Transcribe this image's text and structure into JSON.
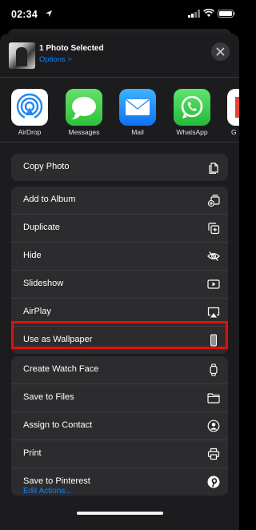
{
  "status_bar": {
    "time": "02:34"
  },
  "header": {
    "title": "1 Photo Selected",
    "options_label": "Options >"
  },
  "apps": [
    {
      "label": "AirDrop"
    },
    {
      "label": "Messages"
    },
    {
      "label": "Mail"
    },
    {
      "label": "WhatsApp"
    },
    {
      "label": "G"
    }
  ],
  "actions_group1": [
    {
      "label": "Copy Photo",
      "icon": "copy-icon"
    }
  ],
  "actions_group2": [
    {
      "label": "Add to Album",
      "icon": "add-to-album-icon"
    },
    {
      "label": "Duplicate",
      "icon": "duplicate-icon"
    },
    {
      "label": "Hide",
      "icon": "eye-slash-icon"
    },
    {
      "label": "Slideshow",
      "icon": "play-icon"
    },
    {
      "label": "AirPlay",
      "icon": "airplay-icon"
    },
    {
      "label": "Use as Wallpaper",
      "icon": "phone-icon"
    }
  ],
  "actions_group3": [
    {
      "label": "Create Watch Face",
      "icon": "watch-icon"
    },
    {
      "label": "Save to Files",
      "icon": "folder-icon"
    },
    {
      "label": "Assign to Contact",
      "icon": "contact-icon"
    },
    {
      "label": "Print",
      "icon": "printer-icon"
    },
    {
      "label": "Save to Pinterest",
      "icon": "pinterest-icon"
    }
  ],
  "footer": {
    "edit_actions": "Edit Actions..."
  },
  "colors": {
    "accent": "#0a84ff",
    "highlight_border": "#e01010",
    "sheet_bg": "#1c1c1e",
    "row_bg": "#2c2c2e"
  }
}
